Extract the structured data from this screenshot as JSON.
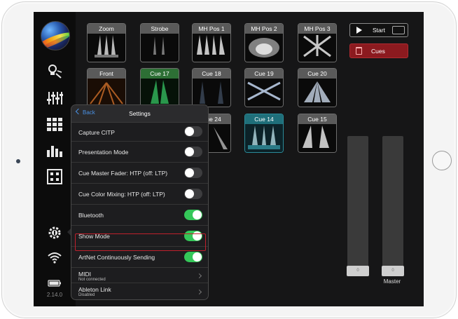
{
  "device": {
    "name": "iPad"
  },
  "sidebar": {
    "icons": [
      "lamp-fixture-icon",
      "faders-icon",
      "grid-icon",
      "equalizer-icon",
      "patch-icon",
      "settings-gear-icon",
      "wifi-icon",
      "battery-icon"
    ],
    "version": "2.14.0"
  },
  "scenes": [
    {
      "label": "Zoom",
      "style": "dim"
    },
    {
      "label": "Strobe",
      "style": "dim"
    },
    {
      "label": "MH Pos 1",
      "style": "dim"
    },
    {
      "label": "MH Pos 2",
      "style": "dim"
    },
    {
      "label": "MH Pos 3",
      "style": "dim"
    },
    {
      "label": "Front",
      "style": "dim"
    },
    {
      "label": "Cue 17",
      "style": "green"
    },
    {
      "label": "Cue 18",
      "style": "normal"
    },
    {
      "label": "Cue 19",
      "style": "normal"
    },
    {
      "label": "Cue 20",
      "style": "normal"
    },
    {
      "label": "Cue 24",
      "style": "normal"
    },
    {
      "label": "Cue 14",
      "style": "teal"
    },
    {
      "label": "Cue 15",
      "style": "normal"
    }
  ],
  "controls": {
    "start_label": "Start",
    "cues_label": "Cues"
  },
  "faders": {
    "handle_text": "0",
    "master_label": "Master"
  },
  "settings": {
    "back_label": "Back",
    "title": "Settings",
    "rows": [
      {
        "label": "Capture CITP",
        "type": "switch",
        "on": false
      },
      {
        "label": "Presentation Mode",
        "type": "switch",
        "on": false
      },
      {
        "label": "Cue Master Fader: HTP (off: LTP)",
        "type": "switch",
        "on": false
      },
      {
        "label": "Cue Color Mixing: HTP (off: LTP)",
        "type": "switch",
        "on": false
      },
      {
        "label": "Bluetooth",
        "type": "switch",
        "on": true
      },
      {
        "label": "Show Mode",
        "type": "switch",
        "on": true
      },
      {
        "label": "ArtNet Continuously Sending",
        "type": "switch",
        "on": true
      },
      {
        "label": "MIDI",
        "sub": "Not connected",
        "type": "link"
      },
      {
        "label": "Ableton Link",
        "sub": "Disabled",
        "type": "link"
      }
    ]
  },
  "colors": {
    "switch_on": "#35c759",
    "cues_button": "#8c1a1f",
    "highlight": "#c0202c",
    "back_link": "#4a90e2"
  }
}
